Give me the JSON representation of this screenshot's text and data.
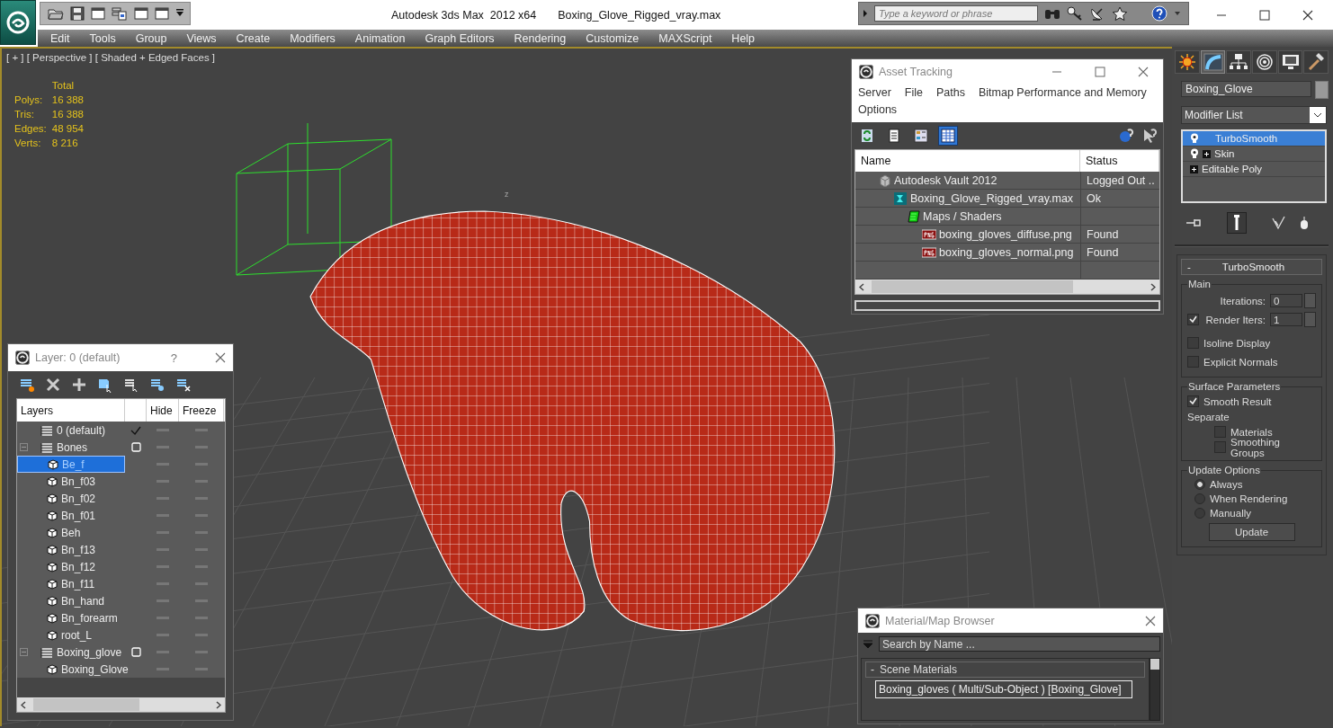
{
  "title_bar": {
    "app": "Autodesk 3ds Max  2012 x64",
    "file": "Boxing_Glove_Rigged_vray.max",
    "quick_access": [
      {
        "kind": "open"
      },
      {
        "kind": "save"
      },
      {
        "kind": "window"
      },
      {
        "kind": "project"
      },
      {
        "kind": "window"
      },
      {
        "kind": "window"
      },
      {
        "kind": "more"
      }
    ],
    "search": {
      "placeholder": "Type a keyword or phrase"
    }
  },
  "menu": [
    "Edit",
    "Tools",
    "Group",
    "Views",
    "Create",
    "Modifiers",
    "Animation",
    "Graph Editors",
    "Rendering",
    "Customize",
    "MAXScript",
    "Help"
  ],
  "viewport": {
    "label": "[ + ] [ Perspective ] [ Shaded + Edged Faces ]",
    "axis_label": "z",
    "stats": {
      "header": "Total",
      "rows": [
        {
          "label": "Polys:",
          "value": "16 388"
        },
        {
          "label": "Tris:",
          "value": "16 388"
        },
        {
          "label": "Edges:",
          "value": "48 954"
        },
        {
          "label": "Verts:",
          "value": "8 216"
        }
      ]
    }
  },
  "asset_tracking": {
    "title": "Asset Tracking",
    "menus": [
      "Server",
      "File",
      "Paths",
      "Bitmap Performance and Memory",
      "Options"
    ],
    "toolbar": [
      {
        "kind": "refresh",
        "selected": false
      },
      {
        "kind": "list",
        "selected": false
      },
      {
        "kind": "thumbnails",
        "selected": false
      },
      {
        "kind": "table",
        "selected": true
      }
    ],
    "columns": [
      "Name",
      "Status"
    ],
    "rows": [
      {
        "kind": "vault",
        "name": "Autodesk Vault 2012",
        "status": "Logged Out ..",
        "children": [
          {
            "kind": "max",
            "name": "Boxing_Glove_Rigged_vray.max",
            "status": "Ok",
            "children": [
              {
                "kind": "maps",
                "name": "Maps / Shaders",
                "children": [
                  {
                    "kind": "png",
                    "name": "boxing_gloves_diffuse.png",
                    "status": "Found"
                  },
                  {
                    "kind": "png",
                    "name": "boxing_gloves_normal.png",
                    "status": "Found"
                  }
                ]
              }
            ]
          }
        ]
      }
    ]
  },
  "layer_window": {
    "title": "Layer: 0 (default)",
    "help": "?",
    "columns": [
      "Layers",
      "Hide",
      "Freeze"
    ],
    "layers": [
      {
        "name": "0 (default)",
        "active": true
      },
      {
        "name": "Bones",
        "active": false,
        "expanded": true,
        "children": [
          {
            "name": "Be_f",
            "selected": true
          },
          {
            "name": "Bn_f03",
            "selected": false
          },
          {
            "name": "Bn_f02",
            "selected": false
          },
          {
            "name": "Bn_f01",
            "selected": false
          },
          {
            "name": "Beh",
            "selected": false
          },
          {
            "name": "Bn_f13",
            "selected": false
          },
          {
            "name": "Bn_f12",
            "selected": false
          },
          {
            "name": "Bn_f11",
            "selected": false
          },
          {
            "name": "Bn_hand",
            "selected": false
          },
          {
            "name": "Bn_forearm",
            "selected": false
          },
          {
            "name": "root_L",
            "selected": false
          }
        ]
      },
      {
        "name": "Boxing_glove",
        "active": false,
        "expanded": true,
        "children": [
          {
            "name": "Boxing_Glove",
            "selected": false
          }
        ]
      }
    ]
  },
  "command_panel": {
    "tabs": [
      {
        "kind": "create",
        "selected": false
      },
      {
        "kind": "modify",
        "selected": true
      },
      {
        "kind": "hierarchy",
        "selected": false
      },
      {
        "kind": "motion",
        "selected": false
      },
      {
        "kind": "display",
        "selected": false
      },
      {
        "kind": "utilities",
        "selected": false
      }
    ],
    "object_name": "Boxing_Glove",
    "modifier_list": "Modifier List",
    "stack": [
      {
        "name": "TurboSmooth",
        "bulb": true,
        "expandable": false,
        "selected": true
      },
      {
        "name": "Skin",
        "bulb": true,
        "expandable": true,
        "selected": false
      },
      {
        "name": "Editable Poly",
        "bulb": false,
        "expandable": true,
        "selected": false
      }
    ],
    "rollout": {
      "title": "TurboSmooth",
      "collapse": "-",
      "main": {
        "title": "Main",
        "iterations": {
          "label": "Iterations:",
          "value": "0"
        },
        "render_iters": {
          "label": "Render Iters:",
          "value": "1",
          "checked": true
        },
        "isoline": {
          "label": "Isoline Display",
          "checked": false
        },
        "explicit_normals": {
          "label": "Explicit Normals",
          "checked": false
        }
      },
      "surface": {
        "title": "Surface Parameters",
        "smooth_result": {
          "label": "Smooth Result",
          "checked": true
        },
        "separate": "Separate",
        "materials": {
          "label": "Materials",
          "checked": false
        },
        "smoothing_groups": {
          "label": "Smoothing Groups",
          "checked": false
        }
      },
      "update": {
        "title": "Update Options",
        "options": [
          {
            "label": "Always",
            "selected": true
          },
          {
            "label": "When Rendering",
            "selected": false
          },
          {
            "label": "Manually",
            "selected": false
          }
        ],
        "button": "Update"
      }
    }
  },
  "material_browser": {
    "title": "Material/Map Browser",
    "search": {
      "placeholder": "Search by Name ..."
    },
    "group": {
      "toggle": "-",
      "title": "Scene Materials",
      "expanded": true,
      "items": [
        "Boxing_gloves ( Multi/Sub-Object ) [Boxing_Glove]"
      ]
    }
  }
}
